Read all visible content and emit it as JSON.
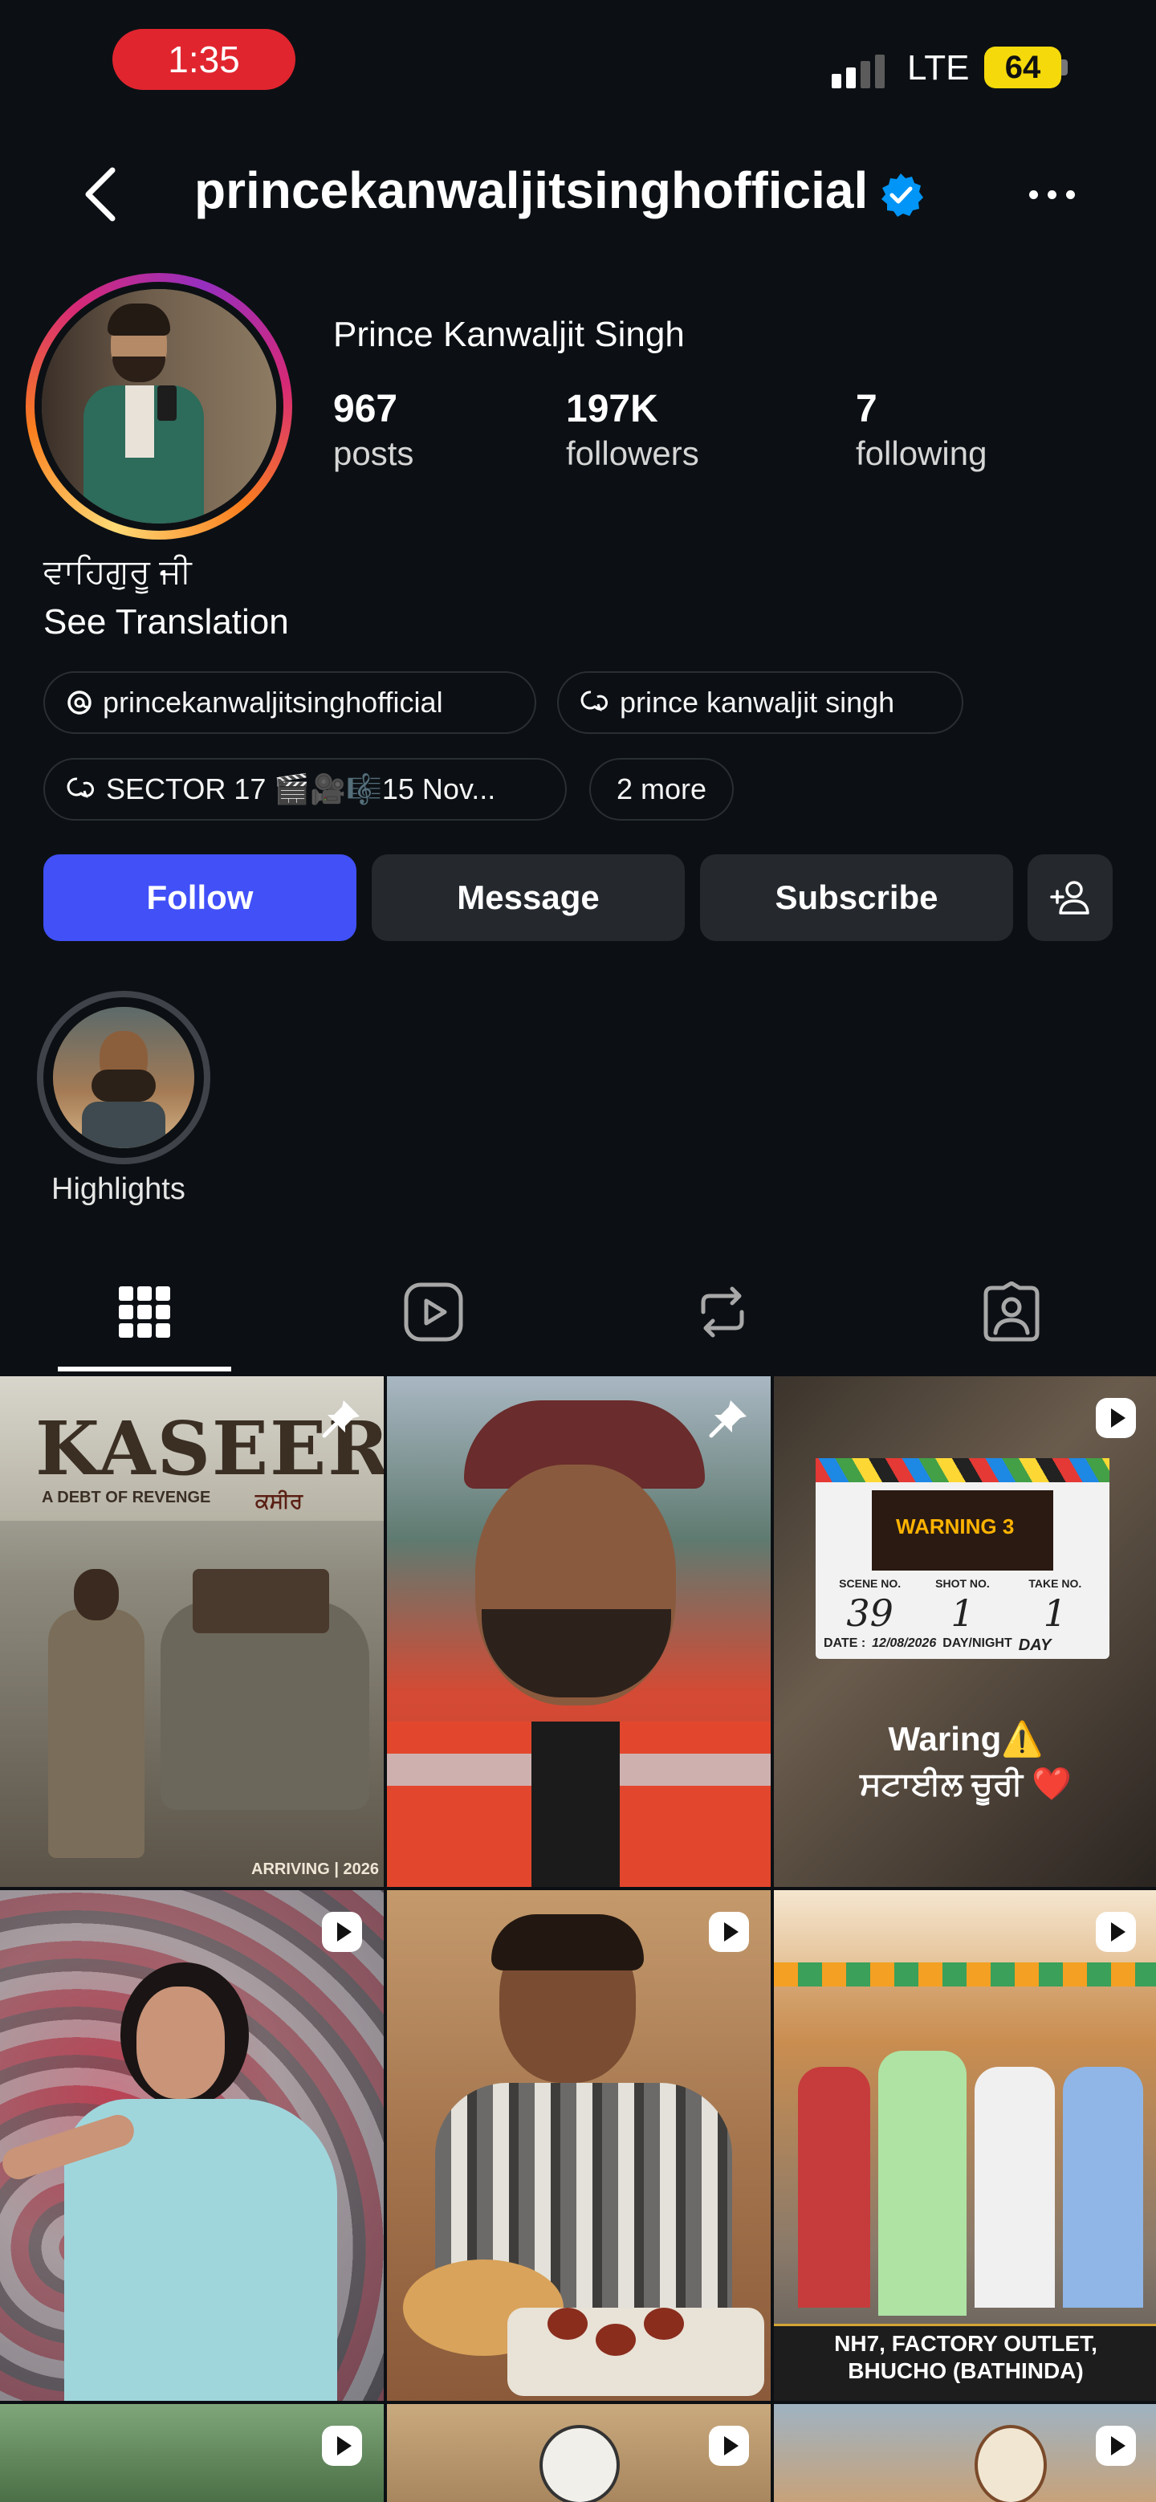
{
  "status_bar": {
    "time": "1:35",
    "network": "LTE",
    "battery": "64"
  },
  "header": {
    "username": "princekanwaljitsinghofficial"
  },
  "profile": {
    "display_name": "Prince Kanwaljit Singh",
    "stats": [
      {
        "value": "967",
        "label": "posts"
      },
      {
        "value": "197K",
        "label": "followers"
      },
      {
        "value": "7",
        "label": "following"
      }
    ],
    "bio": "ਵਾਹਿਗੁਰੂ ਜੀ",
    "see_translation": "See Translation"
  },
  "links": {
    "threads": "princekanwaljitsinghofficial",
    "channel_1": "prince kanwaljit singh",
    "channel_2": "SECTOR 17 🎬🎥🎼15 Nov...",
    "more": "2 more"
  },
  "actions": {
    "follow": "Follow",
    "message": "Message",
    "subscribe": "Subscribe"
  },
  "highlights": [
    {
      "label": "Highlights"
    }
  ],
  "grid": {
    "posts": [
      {
        "type": "pinned",
        "title": "KASEER",
        "subtitle": "A DEBT OF REVENGE",
        "punjabi_title": "ਕਸੀਰ",
        "footer": "ARRIVING | 2026"
      },
      {
        "type": "pinned"
      },
      {
        "type": "reel",
        "clapper": {
          "scene_hdr": "SCENE NO.",
          "shot_hdr": "SHOT NO.",
          "take_hdr": "TAKE NO.",
          "scene": "39",
          "shot": "1",
          "take": "1",
          "date_lbl": "DATE :",
          "date": "12/08/2026",
          "daynight_lbl": "DAY/NIGHT",
          "daynight": "DAY",
          "badge": "WARNING 3"
        },
        "caption_1": "Waring⚠️",
        "caption_2": "ਸਟਾਈਲ ਚੂਰੀ ❤️"
      },
      {
        "type": "reel"
      },
      {
        "type": "reel"
      },
      {
        "type": "reel",
        "caption": "NH7, FACTORY OUTLET, BHUCHO (BATHINDA)"
      },
      {
        "type": "reel"
      },
      {
        "type": "reel"
      },
      {
        "type": "reel"
      }
    ]
  },
  "colors": {
    "follow_blue": "#4150f7",
    "background": "#0c1014",
    "button_gray": "#25292e",
    "verified_blue": "#0095f6",
    "status_red": "#e0252f"
  }
}
